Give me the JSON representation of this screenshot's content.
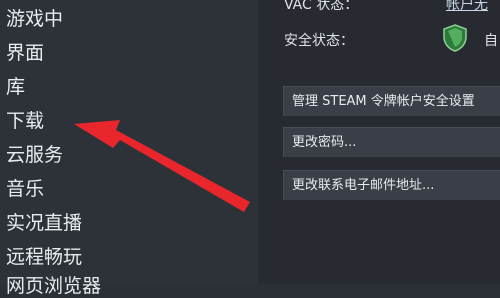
{
  "sidebar": {
    "items": [
      {
        "label": "游戏中"
      },
      {
        "label": "界面"
      },
      {
        "label": "库"
      },
      {
        "label": "下载"
      },
      {
        "label": "云服务"
      },
      {
        "label": "音乐"
      },
      {
        "label": "实况直播"
      },
      {
        "label": "远程畅玩"
      },
      {
        "label": "网页浏览器"
      }
    ]
  },
  "security": {
    "vac_label": "VAC 状态：",
    "vac_value": "帐户无",
    "status_label": "安全状态：",
    "status_value": "自",
    "shield_color": "#3f9a4a"
  },
  "buttons": {
    "manage_guard": "管理 STEAM 令牌帐户安全设置",
    "change_password": "更改密码...",
    "change_email": "更改联系电子邮件地址..."
  },
  "annotation": {
    "arrow_color": "#e8262b"
  }
}
